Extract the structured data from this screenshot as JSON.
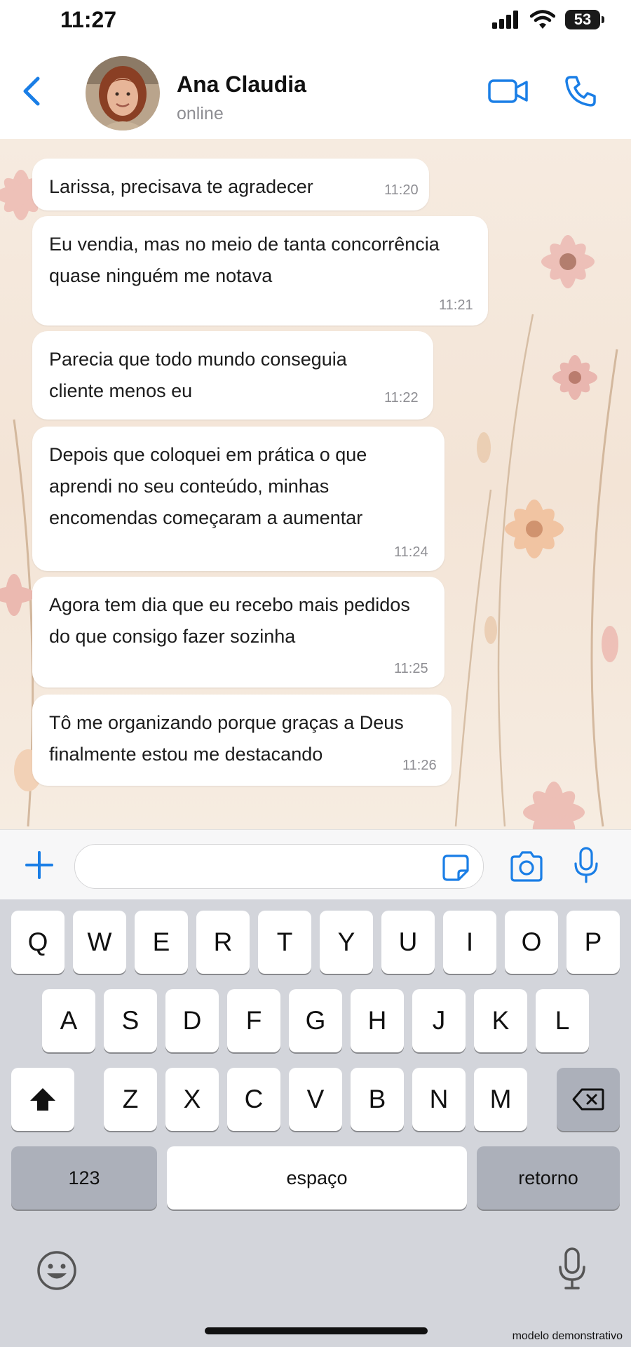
{
  "status_bar": {
    "time": "11:27",
    "battery": "53"
  },
  "header": {
    "contact_name": "Ana Claudia",
    "status": "online"
  },
  "messages": [
    {
      "text": "Larissa, precisava te agradecer",
      "time": "11:20"
    },
    {
      "text": "Eu vendia, mas no meio de tanta concorrência quase ninguém me notava",
      "time": "11:21"
    },
    {
      "text": "Parecia que todo mundo conseguia cliente menos eu",
      "time": "11:22"
    },
    {
      "text": "Depois que coloquei em prática o que aprendi no seu conteúdo, minhas encomendas começaram a aumentar",
      "time": "11:24"
    },
    {
      "text": "Agora tem dia que eu recebo mais pedidos do que consigo fazer sozinha",
      "time": "11:25"
    },
    {
      "text": "Tô me organizando porque graças a Deus finalmente estou me destacando",
      "time": "11:26"
    }
  ],
  "input": {
    "value": ""
  },
  "keyboard": {
    "row1": [
      "Q",
      "W",
      "E",
      "R",
      "T",
      "Y",
      "U",
      "I",
      "O",
      "P"
    ],
    "row2": [
      "A",
      "S",
      "D",
      "F",
      "G",
      "H",
      "J",
      "K",
      "L"
    ],
    "row3": [
      "Z",
      "X",
      "C",
      "V",
      "B",
      "N",
      "M"
    ],
    "numbers_label": "123",
    "space_label": "espaço",
    "return_label": "retorno"
  },
  "watermark": "modelo demonstrativo",
  "colors": {
    "accent": "#1a7ee6",
    "bubble": "#ffffff",
    "keyboard_bg": "#d3d5db"
  },
  "icons": [
    "back-chevron-icon",
    "video-camera-icon",
    "phone-icon",
    "plus-icon",
    "sticker-icon",
    "camera-icon",
    "microphone-icon",
    "shift-icon",
    "backspace-icon",
    "emoji-icon"
  ]
}
